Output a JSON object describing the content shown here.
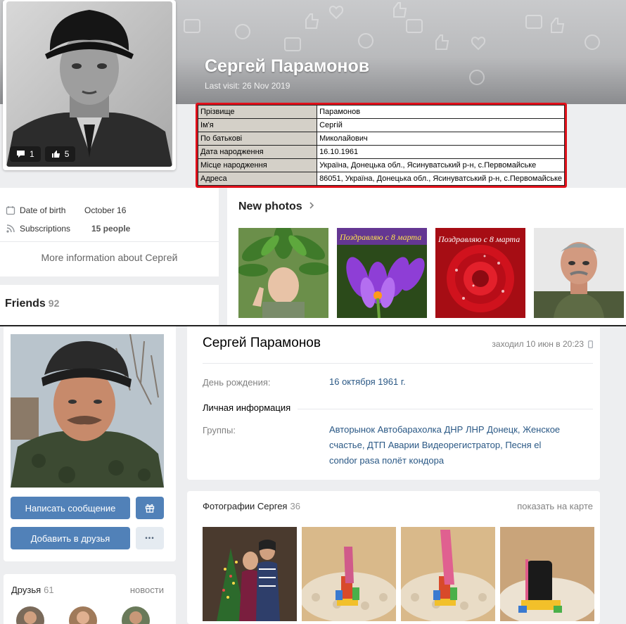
{
  "top": {
    "profile_name": "Сергей Парамонов",
    "last_visit": "Last visit: 26 Nov 2019",
    "avatar_stats": {
      "comments": "1",
      "likes": "5"
    },
    "info_table": [
      {
        "key": "Прізвище",
        "value": "Парамонов"
      },
      {
        "key": "Ім'я",
        "value": "Сергій"
      },
      {
        "key": "По батькові",
        "value": "Миколайович"
      },
      {
        "key": "Дата народження",
        "value": "16.10.1961"
      },
      {
        "key": "Місце народження",
        "value": "Україна, Донецька обл., Ясинуватський р-н, с.Первомайське"
      },
      {
        "key": "Адреса",
        "value": "86051, Україна, Донецька обл., Ясинуватський р-н, с.Первомайське"
      }
    ],
    "date_of_birth_label": "Date of birth",
    "date_of_birth_value": "October 16",
    "subscriptions_label": "Subscriptions",
    "subscriptions_value": "15 people",
    "more_info": "More information about Сергей",
    "friends_label": "Friends",
    "friends_count": "92",
    "new_photos_label": "New photos",
    "photo_captions": [
      "Поздравляю с 8 марта",
      "Поздравляю с 8 марта"
    ]
  },
  "bottom": {
    "profile_name": "Сергей Парамонов",
    "online_status": "заходил 10 июн в 20:23",
    "birthday_label": "День рождения:",
    "birthday_value": "16 октября 1961 г.",
    "personal_info_label": "Личная информация",
    "groups_label": "Группы:",
    "groups": [
      "Авторынок Автобарахолка ДНР ЛНР Донецк",
      "Женское счастье",
      "ДТП Аварии Видеорегистратор",
      "Песня el condor pasa полёт кондора"
    ],
    "groups_line1": "Авторынок Автобарахолка ДНР ЛНР Донецк, Женское",
    "groups_line2": "счастье, ДТП Аварии Видеорегистратор, Песня el",
    "groups_line3": "condor pasa полёт кондора",
    "send_message_label": "Написать сообщение",
    "add_friend_label": "Добавить в друзья",
    "more_label": "•••",
    "friends_label": "Друзья",
    "friends_count": "61",
    "news_label": "новости",
    "photos_label": "Фотографии Сергея",
    "photos_count": "36",
    "show_on_map_label": "показать на карте"
  },
  "colors": {
    "accent": "#5181b8",
    "link": "#2a5885",
    "highlight_border": "#e0101a",
    "table_key_bg": "#d4d0c8",
    "page_bg": "#edeef0"
  },
  "icons": [
    "comment-icon",
    "like-icon",
    "calendar-icon",
    "rss-icon",
    "chevron-right-icon",
    "gift-icon",
    "more-icon",
    "mobile-icon"
  ]
}
